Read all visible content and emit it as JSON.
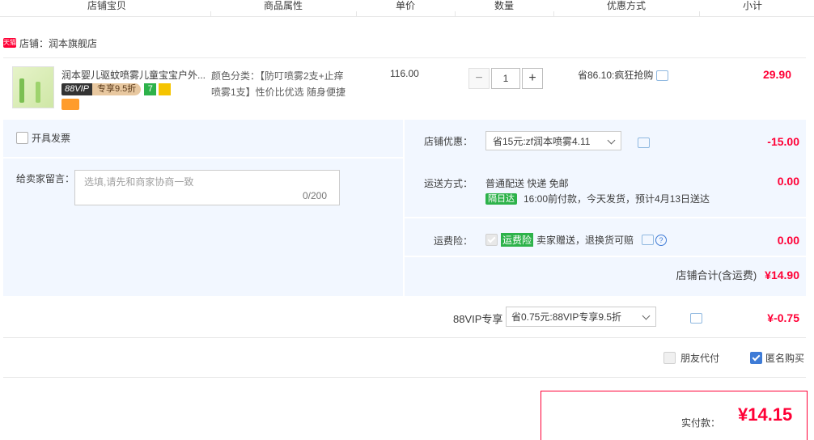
{
  "header": {
    "columns": [
      "店铺宝贝",
      "商品属性",
      "单价",
      "数量",
      "优惠方式",
      "小计"
    ]
  },
  "shop": {
    "badge": "天猫",
    "label": "店铺：润本旗舰店"
  },
  "item": {
    "title": "润本婴儿驱蚊喷雾儿童宝宝户外...",
    "vip_left": "88VIP",
    "vip_right": "专享9.5折",
    "tag_seven": "7",
    "props_line1": "颜色分类：【防叮喷雾2支+止痒",
    "props_line2": "喷雾1支】性价比优选 随身便捷",
    "price": "116.00",
    "quantity": "1",
    "promo": "省86.10:疯狂抢购",
    "subtotal": "29.90"
  },
  "options": {
    "invoice_label": "开具发票",
    "message_label": "给卖家留言：",
    "message_placeholder": "选填,请先和商家协商一致",
    "message_count": "0/200",
    "shop_discount_label": "店铺优惠：",
    "shop_discount_value": "省15元:zf润本喷雾4.11",
    "shop_discount_amount": "-15.00",
    "shipping_label": "运送方式：",
    "shipping_line1": "普通配送 快递 免邮",
    "shipping_tag": "隔日达",
    "shipping_line2": "16:00前付款，今天发货，预计4月13日送达",
    "shipping_amount": "0.00",
    "insurance_label": "运费险：",
    "insurance_tag": "运费险",
    "insurance_text": "卖家赠送，退换货可赔",
    "insurance_amount": "0.00"
  },
  "totals": {
    "shop_total_label": "店铺合计(含运费)",
    "shop_total_value": "¥14.90",
    "vip_label": "88VIP专享",
    "vip_select": "省0.75元:88VIP专享9.5折",
    "vip_amount": "¥-0.75",
    "friend_pay_label": "朋友代付",
    "anonymous_label": "匿名购买",
    "final_label": "实付款：",
    "final_value": "¥14.15"
  },
  "colors": {
    "accent_red": "#ff0036",
    "panel_blue": "#f2f7ff",
    "green_tag": "#2db24a"
  }
}
